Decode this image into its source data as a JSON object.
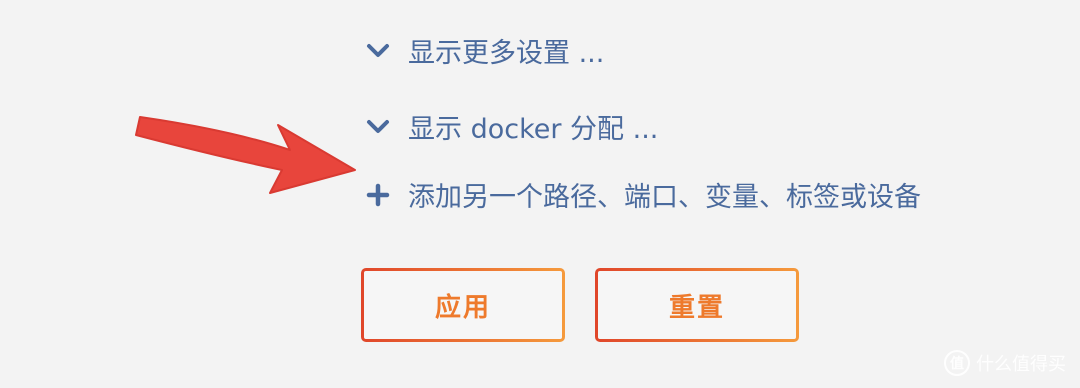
{
  "links": {
    "show_more_settings": "显示更多设置 ...",
    "show_docker_alloc": "显示 docker 分配 ...",
    "add_another": "添加另一个路径、端口、变量、标签或设备"
  },
  "buttons": {
    "apply": "应用",
    "reset": "重置"
  },
  "icons": {
    "expand": "chevron-down-icon",
    "add": "plus-icon",
    "annotation": "red-arrow-icon"
  },
  "colors": {
    "link": "#4a6a9d",
    "button_text": "#ee7a2c",
    "button_border_start": "#e0462a",
    "button_border_end": "#f59a3c",
    "arrow": "#e8453c",
    "background": "#f3f3f3"
  },
  "watermark": {
    "logo_glyph": "值",
    "text": "什么值得买"
  }
}
